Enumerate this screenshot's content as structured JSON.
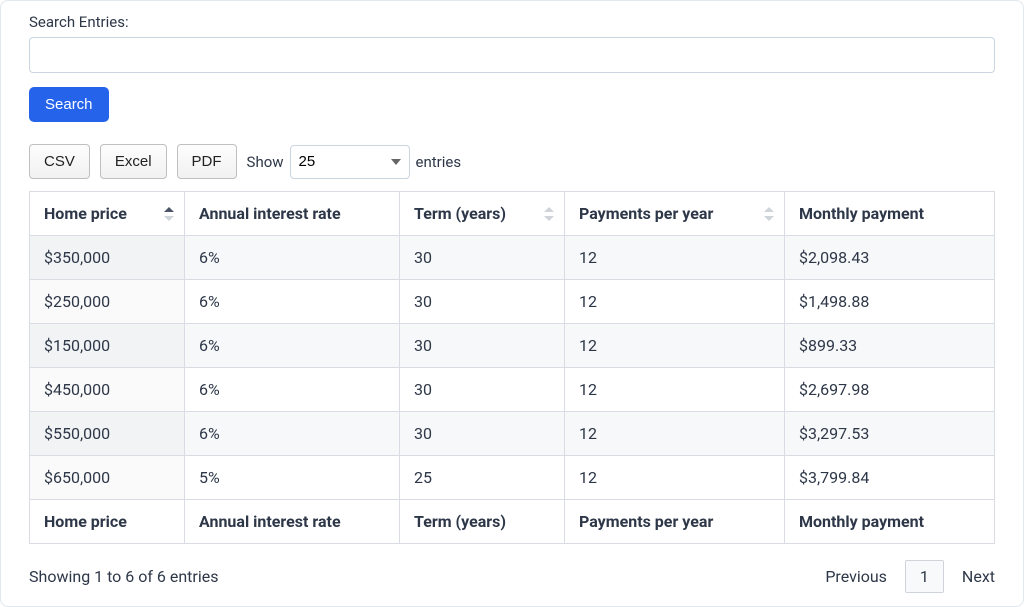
{
  "search": {
    "label": "Search Entries:",
    "value": "",
    "button": "Search"
  },
  "export": {
    "csv": "CSV",
    "excel": "Excel",
    "pdf": "PDF"
  },
  "length": {
    "show": "Show",
    "selected": "25",
    "entries": "entries"
  },
  "columns": {
    "home_price": "Home price",
    "annual_rate": "Annual interest rate",
    "term": "Term (years)",
    "ppy": "Payments per year",
    "monthly": "Monthly payment"
  },
  "rows": [
    {
      "home_price": "$350,000",
      "annual_rate": "6%",
      "term": "30",
      "ppy": "12",
      "monthly": "$2,098.43"
    },
    {
      "home_price": "$250,000",
      "annual_rate": "6%",
      "term": "30",
      "ppy": "12",
      "monthly": "$1,498.88"
    },
    {
      "home_price": "$150,000",
      "annual_rate": "6%",
      "term": "30",
      "ppy": "12",
      "monthly": "$899.33"
    },
    {
      "home_price": "$450,000",
      "annual_rate": "6%",
      "term": "30",
      "ppy": "12",
      "monthly": "$2,697.98"
    },
    {
      "home_price": "$550,000",
      "annual_rate": "6%",
      "term": "30",
      "ppy": "12",
      "monthly": "$3,297.53"
    },
    {
      "home_price": "$650,000",
      "annual_rate": "5%",
      "term": "25",
      "ppy": "12",
      "monthly": "$3,799.84"
    }
  ],
  "info": "Showing 1 to 6 of 6 entries",
  "pager": {
    "previous": "Previous",
    "page": "1",
    "next": "Next"
  }
}
